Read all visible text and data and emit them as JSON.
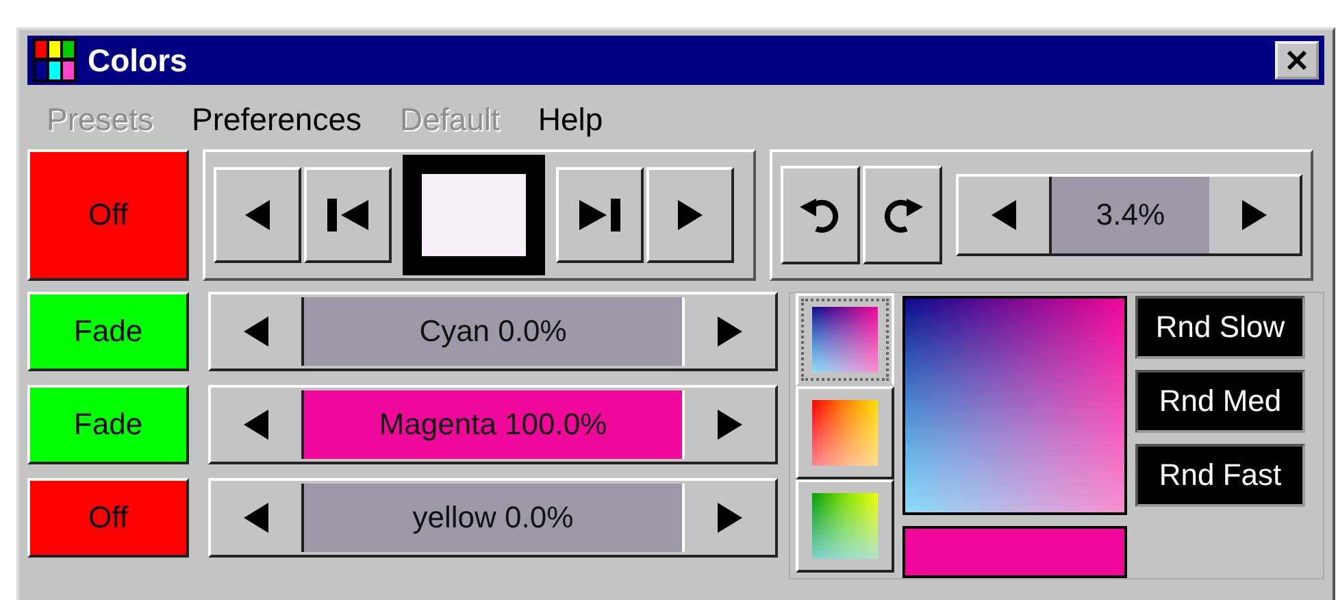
{
  "window": {
    "title": "Colors"
  },
  "menu": [
    {
      "label": "Presets",
      "disabled": true
    },
    {
      "label": "Preferences",
      "disabled": false
    },
    {
      "label": "Default",
      "disabled": true
    },
    {
      "label": "Help",
      "disabled": false
    }
  ],
  "master": {
    "mode": {
      "label": "Off",
      "color": "#ff0000"
    }
  },
  "speed": {
    "reading": "3.4%"
  },
  "channels": [
    {
      "mode": {
        "label": "Fade",
        "color": "#00ff00"
      },
      "label": "Cyan 0.0%",
      "level": 0
    },
    {
      "mode": {
        "label": "Fade",
        "color": "#00ff00"
      },
      "label": "Magenta 100.0%",
      "color": "#f0089a",
      "level": 1
    },
    {
      "mode": {
        "label": "Off",
        "color": "#ff0000"
      },
      "label": "yellow 0.0%",
      "level": 0
    }
  ],
  "palettes": [
    {
      "kind": "blue-pink",
      "selected": true
    },
    {
      "kind": "warm",
      "selected": false
    },
    {
      "kind": "green",
      "selected": false
    }
  ],
  "random_buttons": [
    "Rnd Slow",
    "Rnd Med",
    "Rnd Fast"
  ]
}
